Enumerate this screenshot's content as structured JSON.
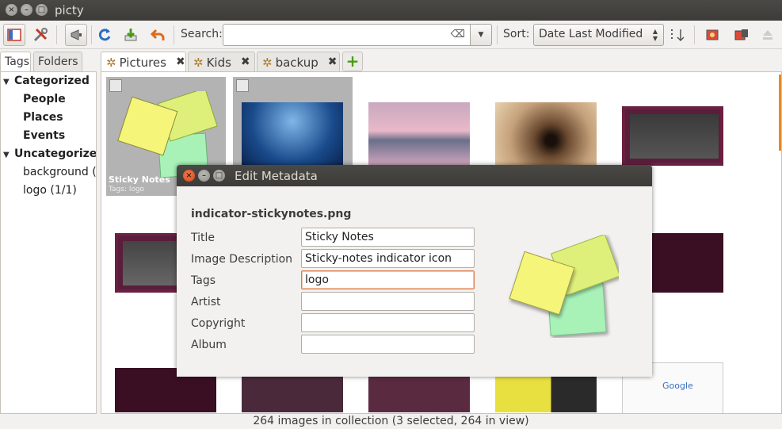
{
  "window": {
    "title": "picty"
  },
  "toolbar": {
    "search_label": "Search:",
    "search_value": "",
    "sort_label": "Sort:",
    "sort_value": "Date Last Modified"
  },
  "left_pane": {
    "tabs": [
      {
        "label": "Tags",
        "active": true
      },
      {
        "label": "Folders",
        "active": false
      }
    ],
    "tree": {
      "categorized": "Categorized",
      "people": "People",
      "places": "Places",
      "events": "Events",
      "uncategorized": "Uncategorized",
      "background": "background (",
      "logo": "logo (1/1)"
    }
  },
  "browser": {
    "tabs": [
      {
        "label": "Pictures",
        "active": true
      },
      {
        "label": "Kids",
        "active": false
      },
      {
        "label": "backup",
        "active": false
      }
    ],
    "selected_caption": "Sticky Notes",
    "selected_tags": "Tags: logo"
  },
  "status": {
    "text": "264 images in collection (3 selected, 264 in view)"
  },
  "dialog": {
    "title": "Edit Metadata",
    "filename": "indicator-stickynotes.png",
    "fields": [
      {
        "label": "Title",
        "value": "Sticky Notes"
      },
      {
        "label": "Image Description",
        "value": "Sticky-notes indicator icon"
      },
      {
        "label": "Tags",
        "value": "logo"
      },
      {
        "label": "Artist",
        "value": ""
      },
      {
        "label": "Copyright",
        "value": ""
      },
      {
        "label": "Album",
        "value": ""
      }
    ]
  },
  "colors": {
    "accent": "#e07c4b",
    "titlebar": "#3c3b37",
    "selection": "#b3b3b3"
  }
}
